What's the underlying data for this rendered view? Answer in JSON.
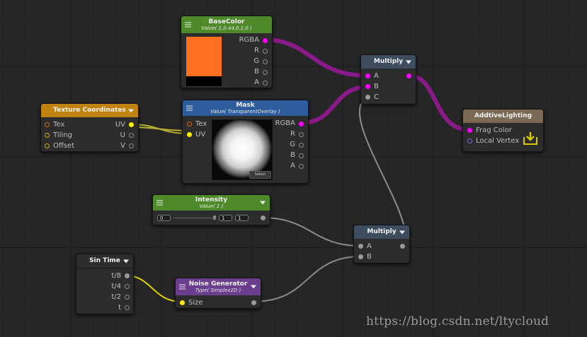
{
  "nodes": {
    "basecolor": {
      "title": "BaseColor",
      "subtitle": "Value( 1,0.44,0.1,0 )",
      "outputs": [
        "RGBA",
        "R",
        "G",
        "B",
        "A"
      ],
      "swatch_color": "#ff7020"
    },
    "mask": {
      "title": "Mask",
      "subtitle": "Value( TransparentOverlay )",
      "inputs": [
        "Tex",
        "UV"
      ],
      "outputs": [
        "RGBA",
        "R",
        "G",
        "B",
        "A"
      ],
      "select_label": "Select"
    },
    "texcoord": {
      "title": "Texture Coordinates",
      "inputs": [
        "Tex",
        "Tiling",
        "Offset"
      ],
      "outputs": [
        "UV",
        "U",
        "V"
      ]
    },
    "multiply_top": {
      "title": "Multiply",
      "inputs": [
        "A",
        "B",
        "C"
      ]
    },
    "additive": {
      "title": "AddtiveLighting",
      "inputs": [
        "Frag Color",
        "Local Vertex"
      ]
    },
    "intensity": {
      "title": "Intensity",
      "subtitle": "Value( 1 )",
      "slider_min": "0",
      "slider_max": "1",
      "value": "1"
    },
    "multiply_bottom": {
      "title": "Multiply",
      "inputs": [
        "A",
        "B"
      ]
    },
    "sintime": {
      "title": "Sin Time",
      "outputs": [
        "t/8",
        "t/4",
        "t/2",
        "t"
      ]
    },
    "noise": {
      "title": "Noise Generator",
      "subtitle": "Type( Simplex2D )",
      "inputs": [
        "Size"
      ]
    }
  },
  "header_colors": {
    "basecolor": "#4f8a2a",
    "mask": "#2e5c9c",
    "texcoord": "#c2820e",
    "multiply": "#3d4d5e",
    "additive": "#7a6a55",
    "intensity": "#4f8a2a",
    "sintime": "#2d2d2d",
    "noise": "#6a3e8c"
  },
  "wire_colors": {
    "color": "#8a1a8a",
    "float": "#8c8c8c",
    "vector2": "#b8b030"
  },
  "watermark": "https://blog.csdn.net/ltycloud"
}
